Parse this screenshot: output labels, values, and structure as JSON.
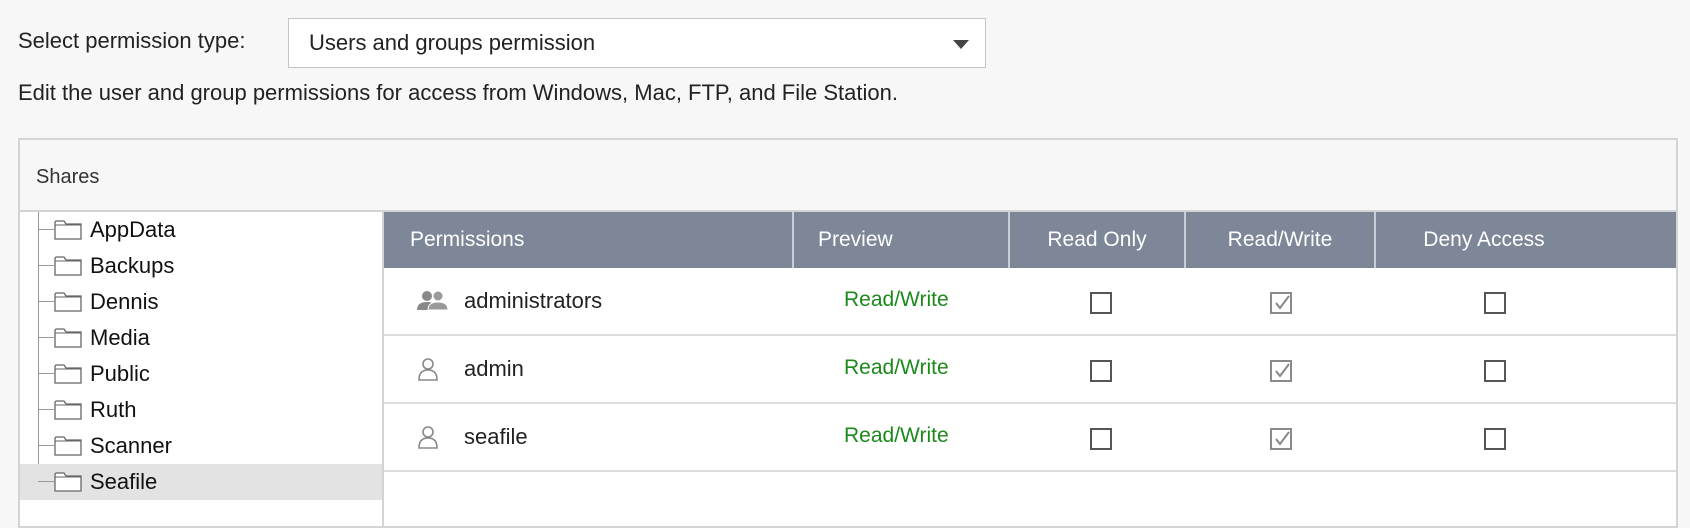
{
  "permission": {
    "label": "Select permission type:",
    "selected": "Users and groups permission"
  },
  "description": "Edit the user and group permissions for access from Windows, Mac, FTP, and File Station.",
  "shares": {
    "title": "Shares",
    "folders": [
      {
        "label": "AppData",
        "selected": false
      },
      {
        "label": "Backups",
        "selected": false
      },
      {
        "label": "Dennis",
        "selected": false
      },
      {
        "label": "Media",
        "selected": false
      },
      {
        "label": "Public",
        "selected": false
      },
      {
        "label": "Ruth",
        "selected": false
      },
      {
        "label": "Scanner",
        "selected": false
      },
      {
        "label": "Seafile",
        "selected": true
      }
    ]
  },
  "grid": {
    "columns": [
      "Permissions",
      "Preview",
      "Read Only",
      "Read/Write",
      "Deny Access"
    ],
    "rows": [
      {
        "name": "administrators",
        "type": "group",
        "icon": "user-group-icon",
        "preview": "Read/Write",
        "read_only": false,
        "read_write": true,
        "deny": false
      },
      {
        "name": "admin",
        "type": "user",
        "icon": "user-icon",
        "preview": "Read/Write",
        "read_only": false,
        "read_write": true,
        "deny": false
      },
      {
        "name": "seafile",
        "type": "user",
        "icon": "user-icon",
        "preview": "Read/Write",
        "read_only": false,
        "read_write": true,
        "deny": false
      }
    ]
  },
  "colors": {
    "header_bg": "#7d8797",
    "preview_green": "#1b8a1b",
    "selected_row": "#e3e3e3"
  }
}
